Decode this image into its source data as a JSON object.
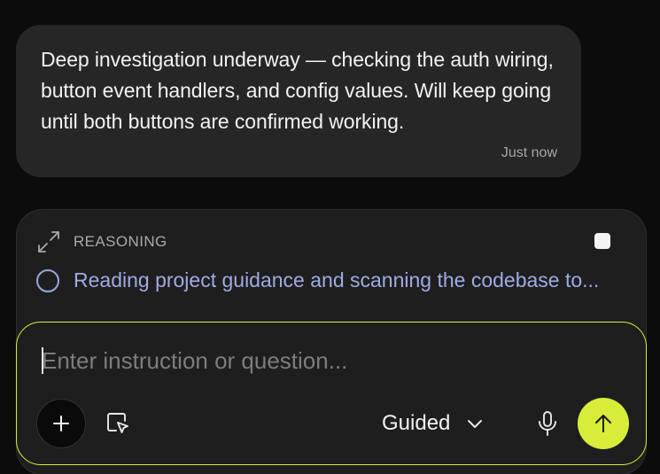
{
  "message": {
    "text": "Deep investigation underway — checking the auth wiring, button event handlers, and config values. Will keep going until both buttons are confirmed working.",
    "timestamp": "Just now"
  },
  "reasoning": {
    "label": "REASONING",
    "step": "Reading project guidance and scanning the codebase to...",
    "expand_icon": "expand-arrows-icon",
    "stop_icon": "stop-square-icon",
    "step_icon": "circle-pending-icon"
  },
  "composer": {
    "placeholder": "Enter instruction or question...",
    "mode_label": "Guided",
    "add_icon": "plus-icon",
    "select_icon": "cursor-select-icon",
    "mode_icon": "chevron-down-icon",
    "mic_icon": "microphone-icon",
    "send_icon": "arrow-up-icon"
  },
  "colors": {
    "background": "#0c0c0c",
    "bubble": "#262626",
    "panel": "#1e1e1f",
    "accent": "#d8ec3a",
    "step_text": "#9fabe3"
  }
}
